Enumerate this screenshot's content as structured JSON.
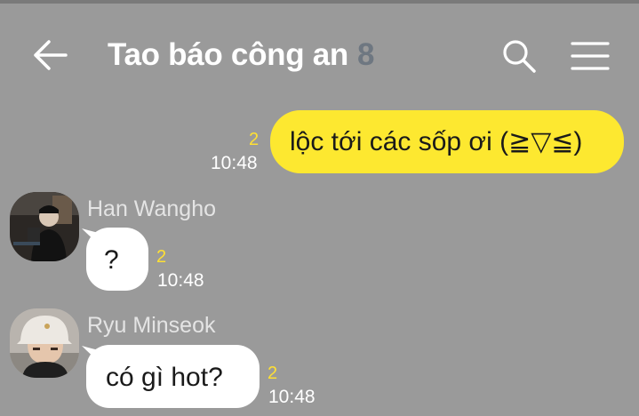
{
  "header": {
    "title": "Tao báo công an",
    "member_count": "8",
    "back_icon": "arrow-left-icon",
    "search_icon": "search-icon",
    "menu_icon": "hamburger-menu-icon"
  },
  "colors": {
    "background": "#9a9a9a",
    "own_bubble": "#fde830",
    "other_bubble": "#ffffff",
    "unread_count": "#ffe033"
  },
  "messages": [
    {
      "sender": "",
      "own": true,
      "text": "lộc tới các sốp ơi (≧▽≦)",
      "unread": "2",
      "time": "10:48"
    },
    {
      "sender": "Han Wangho",
      "own": false,
      "text": "?",
      "unread": "2",
      "time": "10:48"
    },
    {
      "sender": "Ryu Minseok",
      "own": false,
      "text": "có gì hot?",
      "unread": "2",
      "time": "10:48"
    }
  ]
}
